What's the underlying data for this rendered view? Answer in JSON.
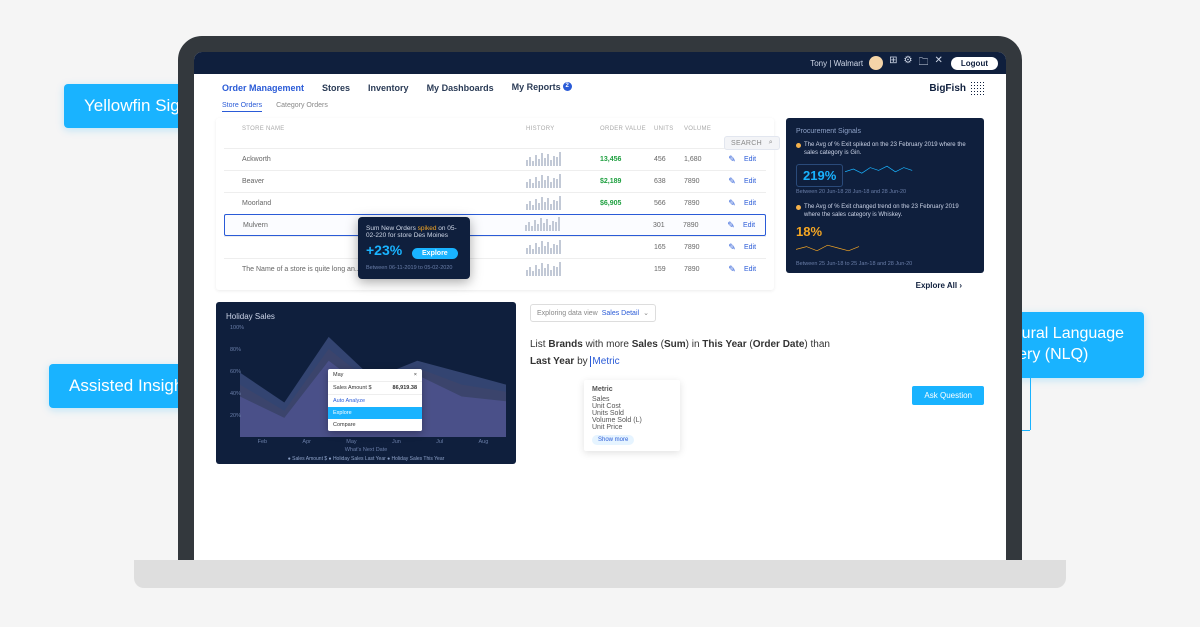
{
  "callouts": {
    "signals": "Yellowfin Signals",
    "insights": "Assisted Insights",
    "nlq_l1": "Natural Language",
    "nlq_l2": "Query (NLQ)"
  },
  "header": {
    "user": "Tony | Walmart",
    "logout": "Logout"
  },
  "nav": {
    "items": [
      "Order Management",
      "Stores",
      "Inventory",
      "My Dashboards",
      "My Reports"
    ],
    "badge": "2",
    "brand": "BigFish"
  },
  "subtabs": {
    "a": "Store Orders",
    "b": "Category Orders"
  },
  "table": {
    "headers": [
      "STORE NAME",
      "HISTORY",
      "ORDER VALUE",
      "UNITS",
      "VOLUME"
    ],
    "search": "Search",
    "rows": [
      {
        "pin": "red",
        "name": "Ackworth",
        "value": "13,456",
        "units": "456",
        "volume": "1,680"
      },
      {
        "pin": "",
        "name": "Beaver",
        "value": "$2,189",
        "units": "638",
        "volume": "7890"
      },
      {
        "pin": "green",
        "name": "Moorland",
        "value": "$6,905",
        "units": "566",
        "volume": "7890"
      },
      {
        "pin": "",
        "name": "Mulvern",
        "value": "",
        "units": "301",
        "volume": "7890"
      },
      {
        "pin": "",
        "name": "",
        "value": "",
        "units": "165",
        "volume": "7890"
      },
      {
        "pin": "green",
        "name": "The Name of a store is quite long an...",
        "value": "",
        "units": "159",
        "volume": "7890"
      }
    ],
    "edit": "Edit"
  },
  "insight": {
    "t1": "Sum New Orders ",
    "spiked": "spiked",
    "t2": " on 05-02-220 for store Des Moines",
    "pct": "+23%",
    "btn": "Explore",
    "range": "Between 06-11-2019 to 05-02-2020"
  },
  "signals": {
    "title": "Procurement Signals",
    "s1": "The Avg of % Exit spiked on the 23 February 2019 where the sales category is Gin.",
    "p1": "219%",
    "r1": "Between 20 Jun-18 28 Jun-18 and 28 Jun-20",
    "s2": "The Avg of % Exit changed trend on the 23 February 2019 where the sales category is Whiskey.",
    "p2": "18%",
    "r2": "Between 25 Jun-18 to 25 Jan-18 and 28 Jun-20",
    "explore_all": "Explore All  ›"
  },
  "chart": {
    "title": "Holiday Sales",
    "ylabels": [
      "100%",
      "80%",
      "60%",
      "40%",
      "20%"
    ],
    "xlabels": [
      "Feb",
      "Apr",
      "May",
      "Jun",
      "Jul",
      "Aug"
    ],
    "sub": "What's Next Date",
    "legend": "● Sales Amount $  ● Holiday Sales Last Year  ● Holiday Sales This Year",
    "tip_label": "May",
    "tip_v1_label": "Sales Amount $",
    "tip_v1": "86,919.38",
    "tip_menu1": "Auto Analyze",
    "tip_menu2": "Explore",
    "tip_menu3": "Compare"
  },
  "nlq": {
    "head_pre": "Exploring data view",
    "head_dv": "Sales Detail",
    "q1": "List ",
    "q2": "Brands",
    "q3": " with more ",
    "q4": "Sales",
    "q5": " (",
    "q6": "Sum",
    "q7": ") in ",
    "q8": "This Year",
    "q9": " (",
    "q10": "Order Date",
    "q11": ") than ",
    "q12": "Last Year",
    "q13": " by ",
    "q14": "Metric",
    "drop_hd": "Metric",
    "drop": [
      "Sales",
      "Unit Cost",
      "Units Sold",
      "Volume Sold (L)",
      "Unit Price"
    ],
    "drop_more": "Show more",
    "ask": "Ask Question"
  },
  "chart_data": {
    "type": "area",
    "title": "Holiday Sales",
    "x": [
      "Feb",
      "Apr",
      "May",
      "Jun",
      "Jul",
      "Aug"
    ],
    "ylim": [
      0,
      100
    ],
    "series": [
      {
        "name": "Sales Amount $",
        "values": [
          60,
          35,
          95,
          55,
          70,
          60
        ]
      },
      {
        "name": "Holiday Sales Last Year",
        "values": [
          30,
          20,
          70,
          40,
          55,
          38
        ]
      },
      {
        "name": "Holiday Sales This Year",
        "values": [
          45,
          25,
          80,
          48,
          62,
          50
        ]
      }
    ]
  }
}
